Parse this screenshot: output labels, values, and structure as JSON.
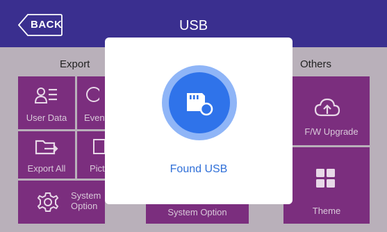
{
  "header": {
    "back_label": "BACK",
    "title": "USB"
  },
  "sections": {
    "export": "Export",
    "others": "Others"
  },
  "tiles": {
    "user_data": "User Data",
    "event": "Event",
    "export_all": "Export All",
    "picture": "Picture",
    "system_option_left": "System Option",
    "system_option_center": "System Option",
    "fw_upgrade": "F/W Upgrade",
    "theme": "Theme"
  },
  "dialog": {
    "message": "Found USB",
    "icon": "usb-drive-icon"
  },
  "colors": {
    "header_bg": "#3a2f8f",
    "tile_bg": "#7b2e7e",
    "accent_blue": "#2f73ea",
    "accent_blue_light": "#8fb5f7",
    "message_text": "#2f6fd8"
  }
}
